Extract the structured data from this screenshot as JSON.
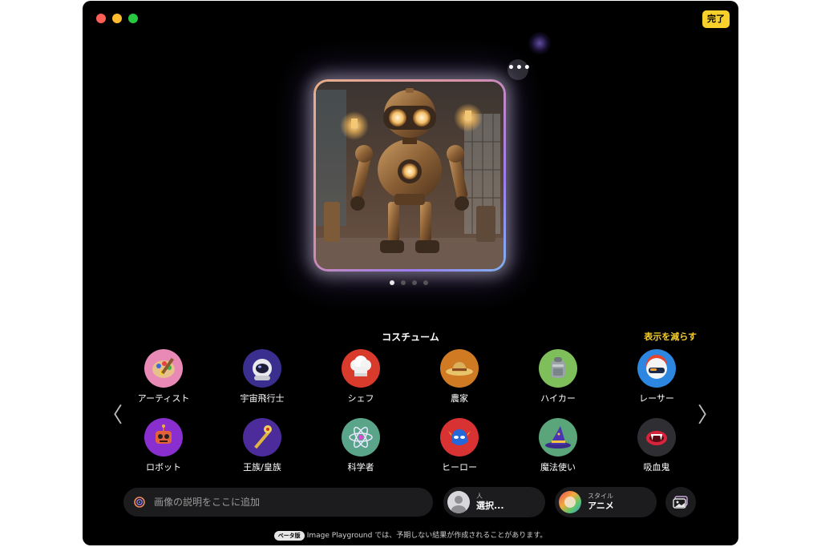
{
  "window": {
    "done_label": "完了",
    "more_label": "•••"
  },
  "preview": {
    "page_count": 4,
    "active_page": 1
  },
  "costume": {
    "section_title": "コスチューム",
    "show_less_label": "表示を減らす",
    "items": [
      {
        "label": "アーティスト",
        "icon": "palette-icon"
      },
      {
        "label": "宇宙飛行士",
        "icon": "astronaut-icon"
      },
      {
        "label": "シェフ",
        "icon": "chef-hat-icon"
      },
      {
        "label": "農家",
        "icon": "straw-hat-icon"
      },
      {
        "label": "ハイカー",
        "icon": "backpack-icon"
      },
      {
        "label": "レーサー",
        "icon": "racing-helmet-icon"
      },
      {
        "label": "ロボット",
        "icon": "robot-icon"
      },
      {
        "label": "王族/皇族",
        "icon": "scepter-icon"
      },
      {
        "label": "科学者",
        "icon": "atom-icon"
      },
      {
        "label": "ヒーロー",
        "icon": "hero-mask-icon"
      },
      {
        "label": "魔法使い",
        "icon": "wizard-hat-icon"
      },
      {
        "label": "吸血鬼",
        "icon": "vampire-mouth-icon"
      }
    ]
  },
  "nav": {
    "prev_label": "〈",
    "next_label": "〉"
  },
  "prompt": {
    "placeholder": "画像の説明をここに追加",
    "value": ""
  },
  "person": {
    "small_label": "人",
    "value": "選択..."
  },
  "style": {
    "small_label": "スタイル",
    "value": "アニメ"
  },
  "footer": {
    "beta_badge": "ベータ版",
    "disclaimer": "Image Playground では、予期しない結果が作成されることがあります。"
  },
  "colors": {
    "accent_yellow": "#f7d02c",
    "background": "#000000",
    "pill_background": "#1c1c1e"
  }
}
